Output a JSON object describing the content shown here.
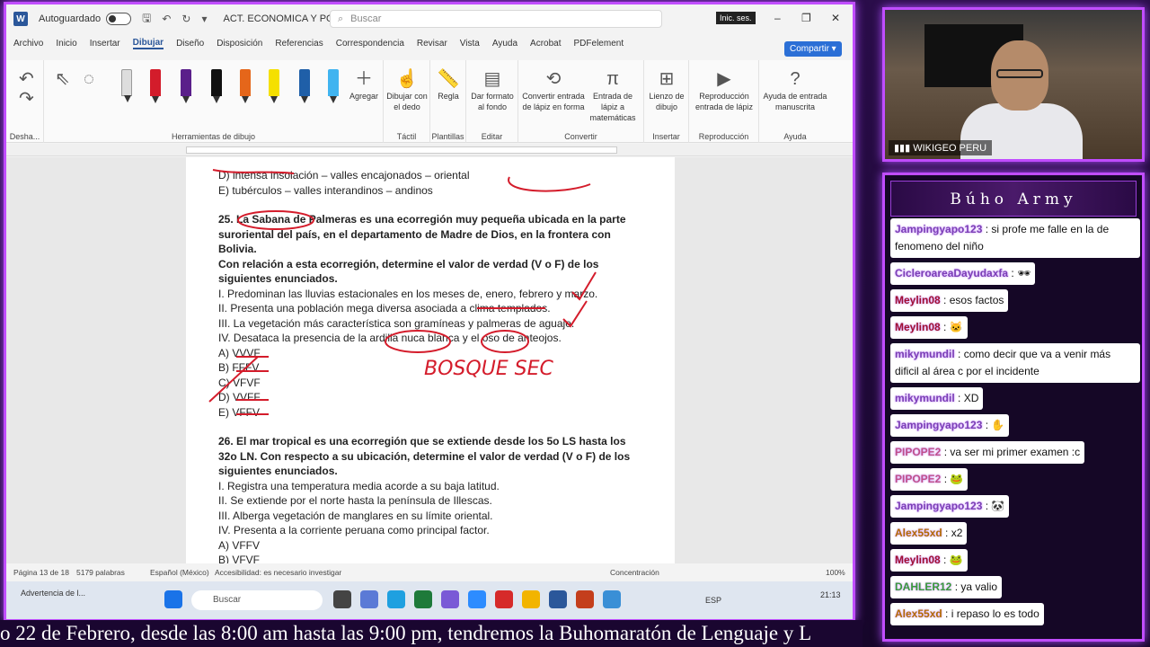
{
  "titlebar": {
    "autosave_label": "Autoguardado",
    "doc_title": "ACT. ECONOMICA Y POL...",
    "search_placeholder": "Buscar",
    "signin_label": "Inic. ses."
  },
  "tabs": [
    "Archivo",
    "Inicio",
    "Insertar",
    "Dibujar",
    "Diseño",
    "Disposición",
    "Referencias",
    "Correspondencia",
    "Revisar",
    "Vista",
    "Ayuda",
    "Acrobat",
    "PDFelement"
  ],
  "active_tab": "Dibujar",
  "share_label": "Compartir",
  "ribbon": {
    "groups": {
      "undo": "Desha...",
      "drawing_tools": "Herramientas de dibujo",
      "touch": "Táctil",
      "stencils": "Plantillas",
      "edit": "Editar",
      "convert": "Convertir",
      "insert": "Insertar",
      "replay": "Reproducción",
      "help": "Ayuda"
    },
    "buttons": {
      "add": "Agregar",
      "draw_finger": "Dibujar con el dedo",
      "ruler": "Regla",
      "format_bg": "Dar formato al fondo",
      "ink_to_shape": "Convertir entrada de lápiz en forma",
      "ink_to_math": "Entrada de lápiz a matemáticas",
      "canvas": "Lienzo de dibujo",
      "ink_replay": "Reproducción entrada de lápiz",
      "ink_help": "Ayuda de entrada manuscrita"
    }
  },
  "document": {
    "lines_top": [
      "D) intensa insolación – valles encajonados – oriental",
      "E) tubérculos – valles interandinos – andinos"
    ],
    "q25_title": [
      "25. La Sabana de Palmeras es una ecorregión muy pequeña ubicada en la parte",
      "suroriental del país, en el departamento de Madre de Dios, en la frontera con",
      "Bolivia.",
      "Con relación a esta ecorregión, determine el valor de verdad (V o F) de los",
      "siguientes enunciados."
    ],
    "q25_items": [
      "I. Predominan las lluvias estacionales en los meses de, enero, febrero y marzo.",
      "II. Presenta una población mega diversa asociada a clima templados.",
      "III. La vegetación más característica son gramíneas y palmeras de aguaje.",
      "IV. Desataca la presencia de la ardilla nuca blanca y el oso de anteojos."
    ],
    "q25_options": [
      "A) VVVF",
      "B) FFFV",
      "C) VFVF",
      "D) VVFF",
      "E) VFFV"
    ],
    "q26_title": [
      "26. El mar tropical es una ecorregión que se extiende desde los 5o LS hasta los",
      "32o LN. Con respecto a su ubicación, determine el valor de verdad (V o F) de los",
      "siguientes enunciados."
    ],
    "q26_items": [
      "I. Registra una temperatura media acorde a su baja latitud.",
      "II. Se extiende por el norte hasta la península de Illescas.",
      "III. Alberga vegetación de manglares en su límite oriental.",
      "IV. Presenta a la corriente peruana como principal factor."
    ],
    "q26_options": [
      "A) VFFV",
      "B) VFVF"
    ],
    "handwriting": "BOSQUE SEC"
  },
  "statusbar": {
    "page": "Página 13 de 18",
    "words": "5179 palabras",
    "language": "Español (México)",
    "accessibility": "Accesibilidad: es necesario investigar",
    "focus": "Concentración",
    "zoom": "100%"
  },
  "taskbar": {
    "warning": "Advertencia de l...",
    "search": "Buscar",
    "lang": "ESP",
    "time": "21:13"
  },
  "webcam": {
    "label": "WIKIGEO PERU"
  },
  "chat": {
    "title": "Búho Army",
    "messages": [
      {
        "user": "Jampingyapo123",
        "text": "si profe me falle en la de fenomeno del niño",
        "cls": "u-purple"
      },
      {
        "user": "CicleroareaDayudaxfa",
        "text": "🕶",
        "cls": "u-purple"
      },
      {
        "user": "Meylin08",
        "text": "esos factos",
        "cls": "u-red"
      },
      {
        "user": "Meylin08",
        "text": "🐱",
        "cls": "u-red"
      },
      {
        "user": "mikymundil",
        "text": "como decir que va a venir más dificil al área c por el incidente",
        "cls": "u-purple"
      },
      {
        "user": "mikymundil",
        "text": "XD",
        "cls": "u-purple"
      },
      {
        "user": "Jampingyapo123",
        "text": "✋",
        "cls": "u-purple"
      },
      {
        "user": "PIPOPE2",
        "text": "va ser mi primer examen :c",
        "cls": "u-pink"
      },
      {
        "user": "PIPOPE2",
        "text": "🐸",
        "cls": "u-pink"
      },
      {
        "user": "Jampingyapo123",
        "text": "🐼",
        "cls": "u-purple"
      },
      {
        "user": "Alex55xd",
        "text": "x2",
        "cls": "u-orange"
      },
      {
        "user": "Meylin08",
        "text": "🐸",
        "cls": "u-red"
      },
      {
        "user": "DAHLER12",
        "text": "ya valio",
        "cls": "u-green"
      },
      {
        "user": "Alex55xd",
        "text": "i repaso lo es todo",
        "cls": "u-orange"
      }
    ]
  },
  "ticker": "o 22 de Febrero, desde las 8:00 am hasta las 9:00 pm, tendremos la Buhomaratón de Lenguaje y L"
}
